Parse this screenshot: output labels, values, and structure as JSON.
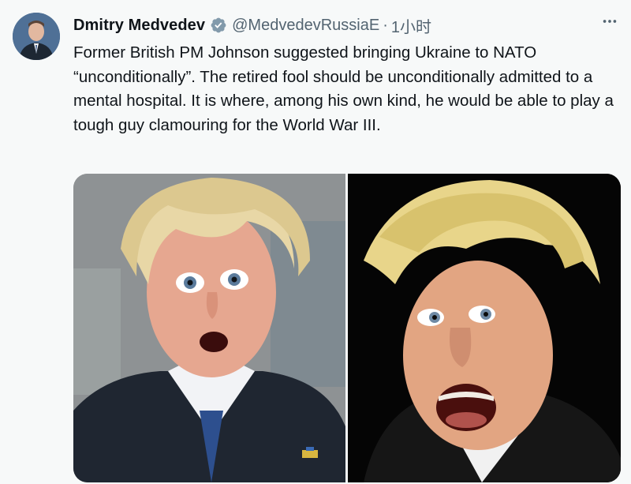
{
  "tweet": {
    "author": {
      "display_name": "Dmitry Medvedev",
      "verified_icon": "verified-badge-icon",
      "handle": "@MedvedevRussiaE",
      "separator": "·",
      "time": "1小时"
    },
    "text": "Former British PM Johnson suggested bringing Ukraine to NATO “unconditionally”. The retired fool should be unconditionally admitted to a mental hospital. It is where, among his own kind, he would be able to play a tough guy clamouring for the World War III.",
    "media": [
      {
        "type": "photo",
        "subject": "left-photo"
      },
      {
        "type": "photo",
        "subject": "right-photo"
      }
    ],
    "more_icon": "more-icon"
  },
  "colors": {
    "background": "#f7f9f9",
    "primary_text": "#0f1419",
    "secondary_text": "#536471",
    "verified": "#1d9bf0"
  }
}
